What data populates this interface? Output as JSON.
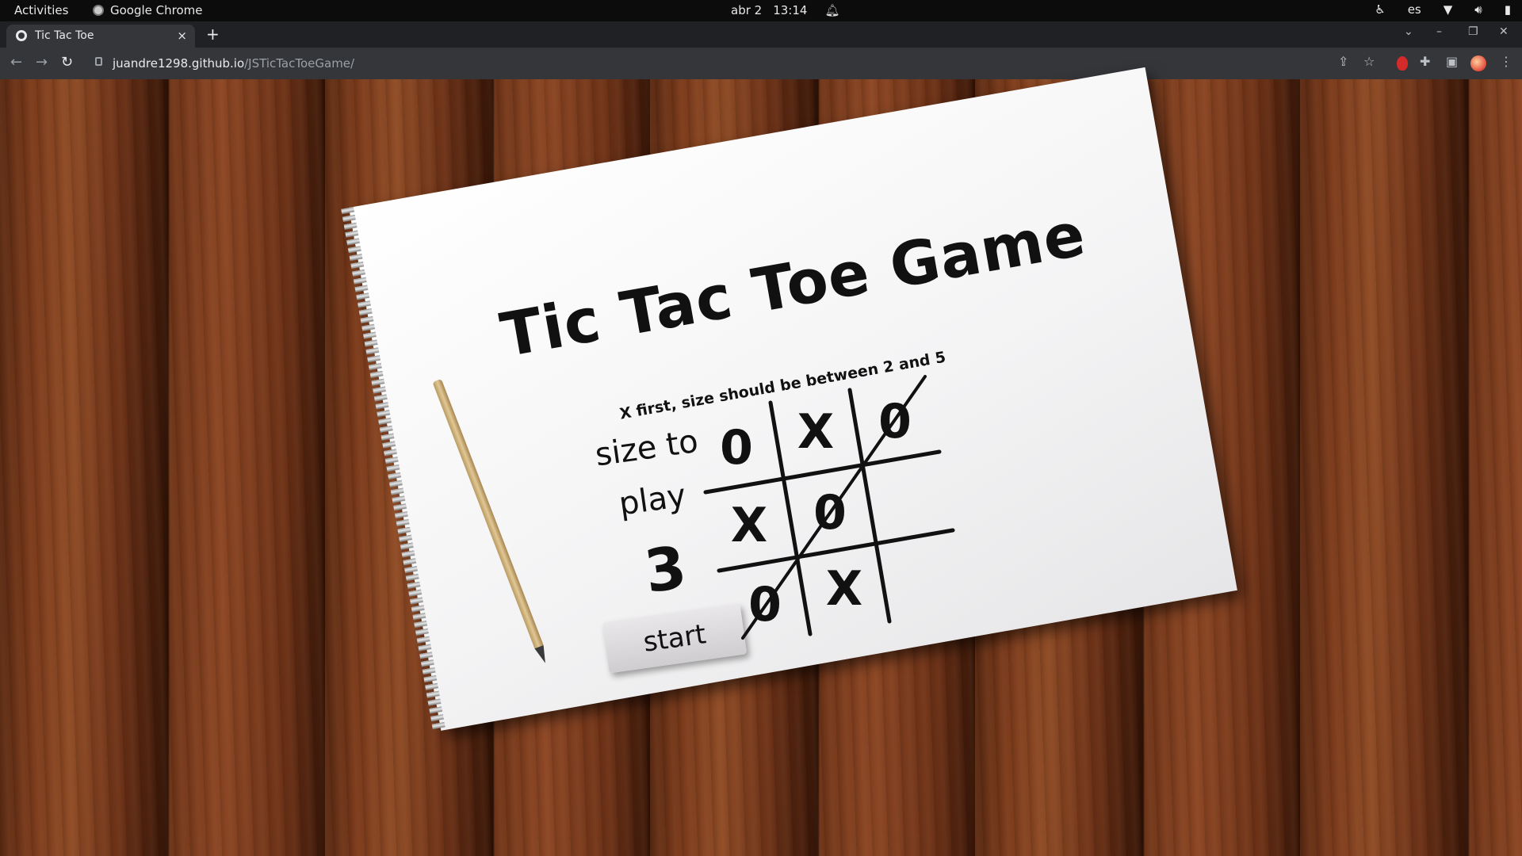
{
  "system_bar": {
    "activities": "Activities",
    "app_name": "Google Chrome",
    "date": "abr 2",
    "time": "13:14",
    "language": "es"
  },
  "browser": {
    "tab_title": "Tic Tac Toe",
    "tab_close": "×",
    "new_tab": "+",
    "url_host": "juandre1298.github.io",
    "url_path": "/JSTicTacToeGame/"
  },
  "game": {
    "title": "Tic Tac Toe Game",
    "hint": "X first, size should be between 2 and 5",
    "size_label_line1": "size to",
    "size_label_line2": "play",
    "size_value": "3",
    "start_label": "start",
    "board": [
      [
        "0",
        "X",
        "0"
      ],
      [
        "X",
        "0",
        ""
      ],
      [
        "0",
        "X",
        ""
      ]
    ],
    "winning_line": "diagonal-bottom-left-to-top-right"
  }
}
